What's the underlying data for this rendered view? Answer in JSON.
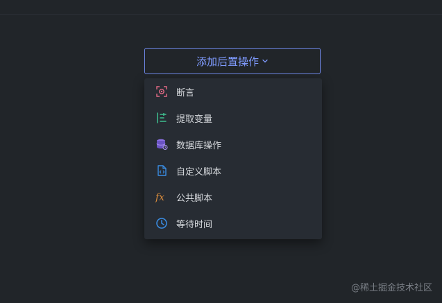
{
  "button": {
    "label": "添加后置操作"
  },
  "menu": {
    "items": [
      {
        "label": "断言",
        "icon": "assertion-icon",
        "color": "#e46a86"
      },
      {
        "label": "提取变量",
        "icon": "extract-variable-icon",
        "color": "#3fbf8f"
      },
      {
        "label": "数据库操作",
        "icon": "database-icon",
        "color": "#8e72e6"
      },
      {
        "label": "自定义脚本",
        "icon": "custom-script-icon",
        "color": "#3a8ee6"
      },
      {
        "label": "公共脚本",
        "icon": "fx-icon",
        "color": "#d88b3c"
      },
      {
        "label": "等待时间",
        "icon": "clock-icon",
        "color": "#3a8ee6"
      }
    ]
  },
  "watermark": "@稀土掘金技术社区"
}
